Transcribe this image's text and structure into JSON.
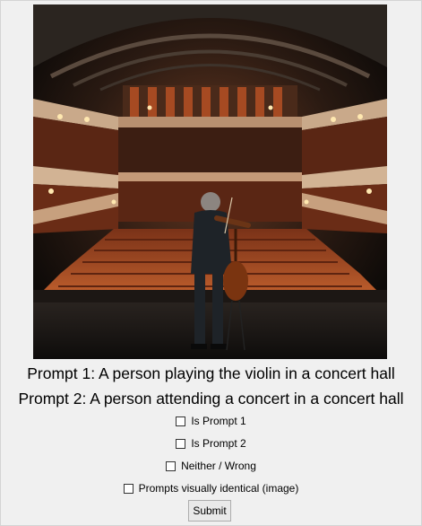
{
  "image": {
    "subject": "violinist-on-stage-concert-hall"
  },
  "prompts": {
    "prompt1": "Prompt 1: A person playing the violin in a concert hall",
    "prompt2": "Prompt 2: A person attending a concert in a concert hall"
  },
  "options": [
    {
      "label": "Is Prompt 1",
      "checked": false
    },
    {
      "label": "Is Prompt 2",
      "checked": false
    },
    {
      "label": "Neither / Wrong",
      "checked": false
    },
    {
      "label": "Prompts visually identical (image)",
      "checked": false
    }
  ],
  "submit_label": "Submit",
  "colors": {
    "background": "#f0f0f0",
    "hall_wood": "#8a3b1c",
    "seats": "#b8562a"
  }
}
